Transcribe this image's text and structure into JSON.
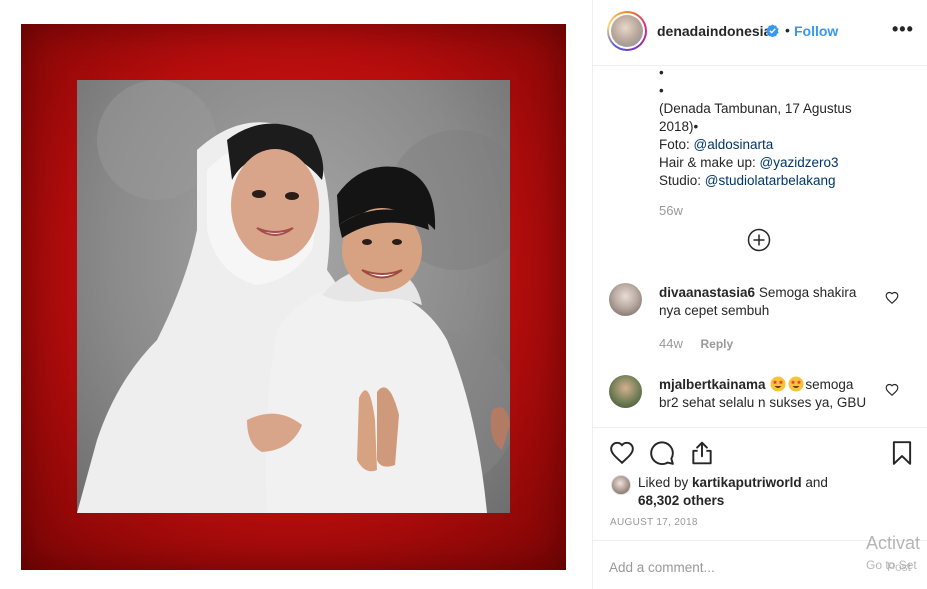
{
  "post": {
    "username": "denadaindonesia",
    "follow_label": "Follow",
    "separator": "•",
    "more_label": "•••",
    "caption_lines": [
      "•",
      "•",
      "(Denada Tambunan, 17 Agustus",
      "2018)•"
    ],
    "credits": [
      {
        "label": "Foto: ",
        "handle": "@aldosinarta"
      },
      {
        "label": "Hair & make up: ",
        "handle": "@yazidzero3"
      },
      {
        "label": "Studio: ",
        "handle": "@studiolatarbelakang"
      }
    ],
    "time": "56w"
  },
  "comments": [
    {
      "username": "divaanastasia6",
      "text": "Semoga shakira nya cepet sembuh",
      "time": "44w",
      "reply_label": "Reply"
    },
    {
      "username": "mjalbertkainama",
      "emoji": [
        "star-struck-emoji",
        "star-struck-emoji"
      ],
      "text": "semoga br2 sehat selalu n sukses ya, GBU"
    }
  ],
  "likes": {
    "prefix": "Liked by ",
    "user": "kartikaputriworld",
    "mid": " and",
    "count": "68,302 others"
  },
  "date": "AUGUST 17, 2018",
  "comment_box": {
    "placeholder": "Add a comment...",
    "post_label": "Post"
  },
  "watermark": {
    "line1": "Activat",
    "line2": "Go to Set"
  },
  "colors": {
    "accent": "#3897f0",
    "mention": "#003569",
    "frame_red": "#c41212",
    "muted": "#999999"
  },
  "icons": [
    "heart-icon",
    "comment-icon",
    "share-icon",
    "bookmark-icon",
    "plus-circle-icon",
    "verified-badge-icon",
    "star-struck-emoji"
  ]
}
